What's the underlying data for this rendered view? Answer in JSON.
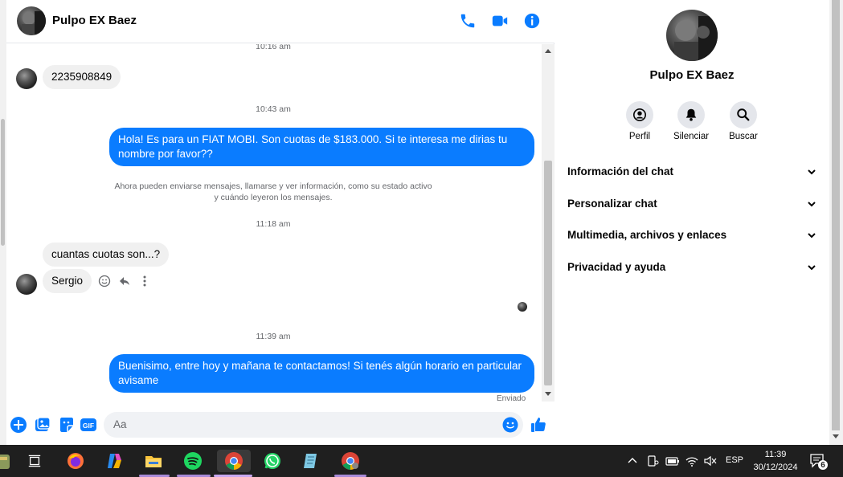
{
  "conversation": {
    "contact_name": "Pulpo EX Baez"
  },
  "messages": {
    "time_top": "10:16 am",
    "incoming_1": "2235908849",
    "time_2": "10:43 am",
    "outgoing_1": "Hola! Es para un FIAT MOBI. Son cuotas de $183.000. Si te interesa me dirias tu nombre por favor??",
    "system_line_1": "Ahora pueden enviarse mensajes, llamarse y ver información, como su estado activo",
    "system_line_2": "y cuándo leyeron los mensajes.",
    "time_3": "11:18 am",
    "incoming_2": "cuantas cuotas son...?",
    "incoming_3": "Sergio",
    "time_4": "11:39 am",
    "outgoing_2": "Buenisimo, entre hoy y mañana te contactamos! Si tenés algún horario en particular avisame",
    "status": "Enviado"
  },
  "composer": {
    "placeholder": "Aa"
  },
  "panel": {
    "name": "Pulpo EX Baez",
    "actions": [
      "Perfil",
      "Silenciar",
      "Buscar"
    ],
    "sections": [
      "Información del chat",
      "Personalizar chat",
      "Multimedia, archivos y enlaces",
      "Privacidad y ayuda"
    ]
  },
  "taskbar": {
    "language": "ESP",
    "time": "11:39",
    "date": "30/12/2024",
    "notification_count": "6"
  },
  "colors": {
    "accent": "#0a7cff",
    "bubble_in": "#f0f0f0",
    "taskbar": "#1f1f1f"
  }
}
